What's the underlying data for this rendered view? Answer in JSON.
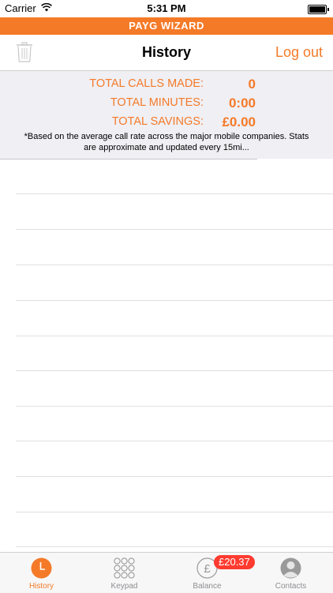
{
  "status_bar": {
    "carrier": "Carrier",
    "time": "5:31 PM"
  },
  "banner": {
    "title": "PAYG WIZARD"
  },
  "navbar": {
    "title": "History",
    "logout_label": "Log out"
  },
  "stats": {
    "rows": [
      {
        "label": "TOTAL CALLS MADE:",
        "value": "0"
      },
      {
        "label": "TOTAL MINUTES:",
        "value": "0:00"
      },
      {
        "label": "TOTAL SAVINGS:",
        "value": "£0.00"
      }
    ],
    "note": "*Based on the average call rate across the major mobile companies. Stats are approximate and updated every 15mi..."
  },
  "tabs": [
    {
      "label": "History",
      "icon": "clock-icon",
      "active": true
    },
    {
      "label": "Keypad",
      "icon": "keypad-icon",
      "active": false
    },
    {
      "label": "Balance",
      "icon": "pound-icon",
      "active": false,
      "badge": "£20.37"
    },
    {
      "label": "Contacts",
      "icon": "person-icon",
      "active": false
    }
  ],
  "colors": {
    "accent": "#F57A28",
    "badge": "#FF3B30"
  }
}
